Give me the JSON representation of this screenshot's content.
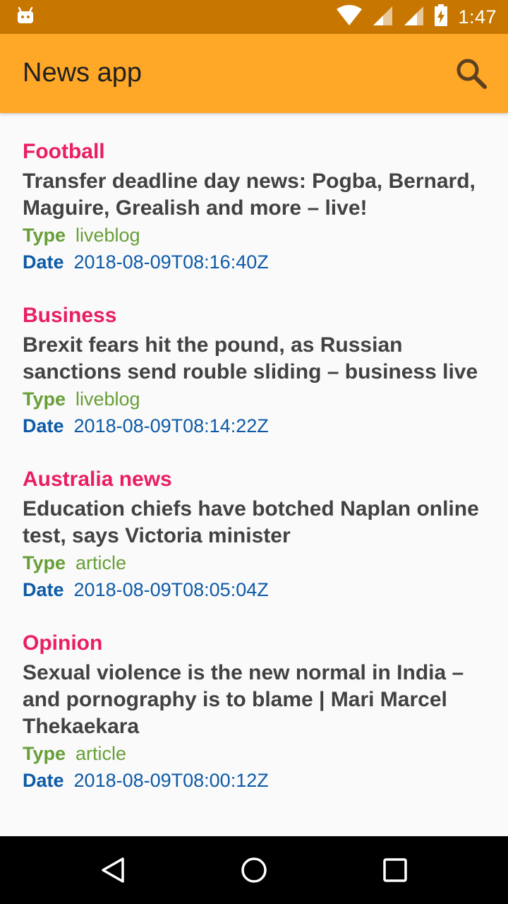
{
  "status_bar": {
    "time": "1:47",
    "icons": [
      "android-icon",
      "wifi-icon",
      "signal-icon",
      "signal-icon",
      "battery-charging-icon"
    ],
    "background": "#c77700"
  },
  "app_bar": {
    "title": "News app",
    "search_icon": "search-icon",
    "background": "#ffa726"
  },
  "labels": {
    "type": "Type",
    "date": "Date"
  },
  "articles": [
    {
      "section": "Football",
      "title": "Transfer deadline day news: Pogba, Bernard, Maguire, Grealish and more – live!",
      "type": "liveblog",
      "date": "2018-08-09T08:16:40Z"
    },
    {
      "section": "Business",
      "title": "Brexit fears hit the pound, as Russian sanctions send rouble sliding – business live",
      "type": "liveblog",
      "date": "2018-08-09T08:14:22Z"
    },
    {
      "section": "Australia news",
      "title": "Education chiefs have botched Naplan online test, says Victoria minister",
      "type": "article",
      "date": "2018-08-09T08:05:04Z"
    },
    {
      "section": "Opinion",
      "title": "Sexual violence is the new normal in India – and pornography is to blame | Mari Marcel Thekaekara",
      "type": "article",
      "date": "2018-08-09T08:00:12Z"
    }
  ],
  "colors": {
    "section": "#e91e63",
    "type": "#689f38",
    "date": "#0d5aa7",
    "headline": "#424242"
  },
  "nav_bar": {
    "icons": [
      "back-icon",
      "home-icon",
      "recents-icon"
    ]
  }
}
